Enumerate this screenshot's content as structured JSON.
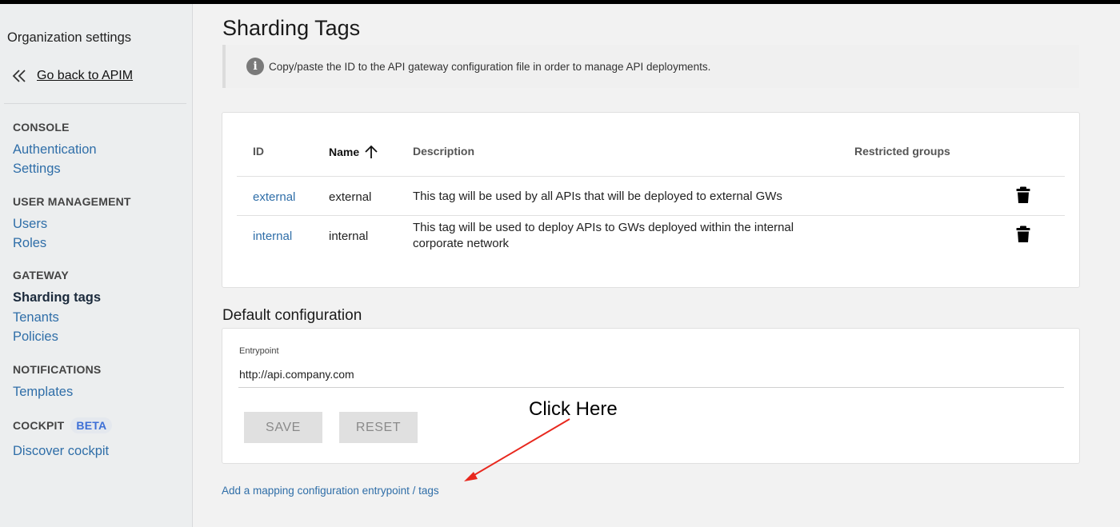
{
  "sidebar": {
    "title": "Organization settings",
    "back_label": "Go back to APIM",
    "sections": [
      {
        "heading": "CONSOLE",
        "items": [
          "Authentication",
          "Settings"
        ]
      },
      {
        "heading": "USER MANAGEMENT",
        "items": [
          "Users",
          "Roles"
        ]
      },
      {
        "heading": "GATEWAY",
        "items": [
          "Sharding tags",
          "Tenants",
          "Policies"
        ]
      },
      {
        "heading": "NOTIFICATIONS",
        "items": [
          "Templates"
        ]
      },
      {
        "heading": "COCKPIT",
        "badge": "BETA",
        "items": [
          "Discover cockpit"
        ]
      }
    ],
    "active_item": "Sharding tags"
  },
  "page": {
    "title": "Sharding Tags",
    "info": "Copy/paste the ID to the API gateway configuration file in order to manage API deployments."
  },
  "table": {
    "columns": [
      "ID",
      "Name",
      "Description",
      "Restricted groups"
    ],
    "sort_column": "Name",
    "sort_direction": "ascending",
    "rows": [
      {
        "id": "external",
        "name": "external",
        "description": "This tag will be used by all APIs that will be deployed to external GWs",
        "restricted_groups": ""
      },
      {
        "id": "internal",
        "name": "internal",
        "description": "This tag will be used to deploy APIs to GWs deployed within the internal corporate network",
        "restricted_groups": ""
      }
    ]
  },
  "default_config": {
    "title": "Default configuration",
    "entrypoint_label": "Entrypoint",
    "entrypoint_value": "http://api.company.com",
    "save_label": "SAVE",
    "reset_label": "RESET"
  },
  "annotation": {
    "text": "Click Here",
    "color": "#e8281e"
  },
  "mapping_link": "Add a mapping configuration entrypoint / tags",
  "colors": {
    "link": "#2f6ea8",
    "active": "#1b2a3c",
    "beta": "#3d6fd6"
  }
}
